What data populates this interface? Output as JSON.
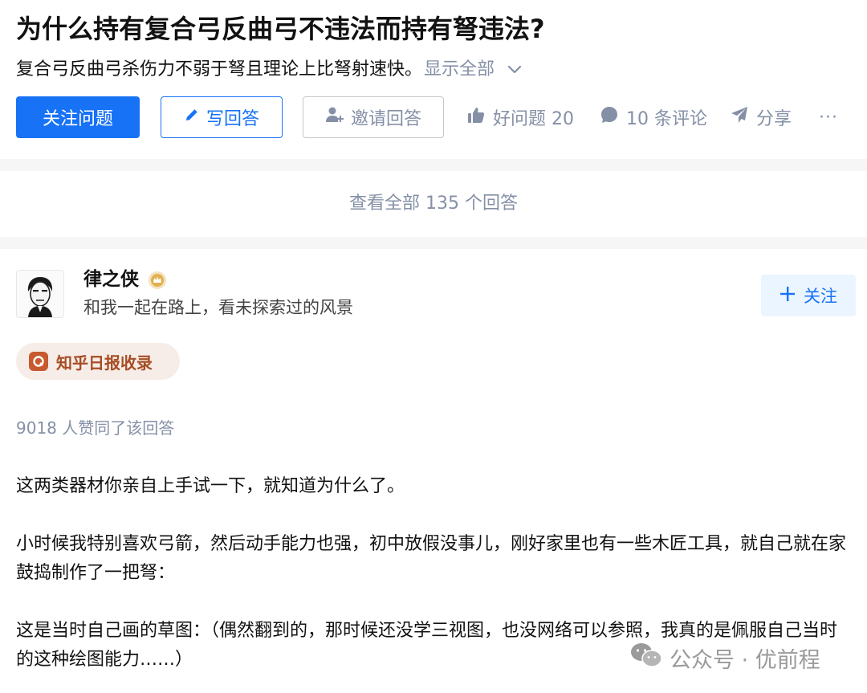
{
  "question": {
    "title": "为什么持有复合弓反曲弓不违法而持有弩违法?",
    "excerpt": "复合弓反曲弓杀伤力不弱于弩且理论上比弩射速快。",
    "show_all": "显示全部"
  },
  "actions": {
    "follow_question": "关注问题",
    "write_answer": "写回答",
    "invite_answer": "邀请回答",
    "good_question": "好问题 20",
    "comments": "10 条评论",
    "share": "分享",
    "more": "···"
  },
  "view_all": "查看全部 135 个回答",
  "answer": {
    "author": {
      "name": "律之侠",
      "bio": "和我一起在路上，看未探索过的风景",
      "follow_label": "关注"
    },
    "tag": "知乎日报收录",
    "votes": "9018 人赞同了该回答",
    "paragraphs": [
      "这两类器材你亲自上手试一下，就知道为什么了。",
      "小时候我特别喜欢弓箭，然后动手能力也强，初中放假没事儿，刚好家里也有一些木匠工具，就自己就在家鼓捣制作了一把弩：",
      "这是当时自己画的草图：（偶然翻到的，那时候还没学三视图，也没网络可以参照，我真的是佩服自己当时的这种绘图能力……）"
    ]
  },
  "watermark": "公众号 · 优前程",
  "colors": {
    "primary_blue": "#1772f6",
    "muted_gray": "#8590a6",
    "tag_brown": "#a74d24",
    "tag_bg": "#f7ede8"
  }
}
